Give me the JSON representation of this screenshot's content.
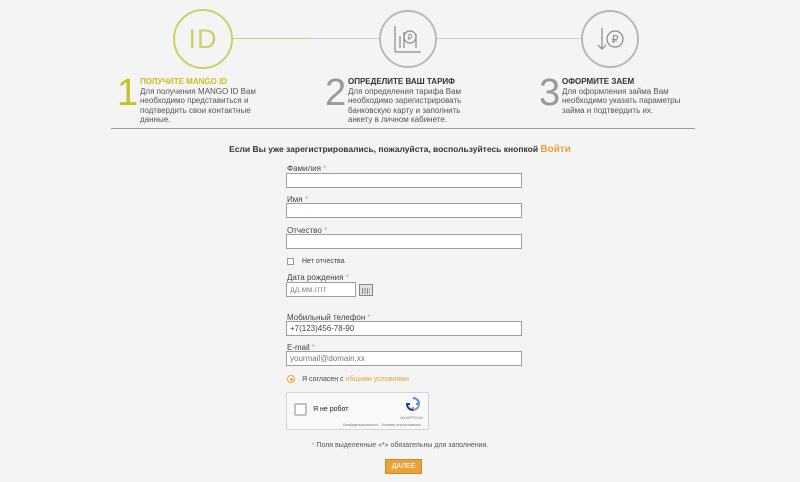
{
  "steps": [
    {
      "number": "1",
      "title": "ПОЛУЧИТЕ MANGO ID",
      "text": "Для получения MANGO ID Вам необходимо представиться и подтвердить свои контактные данные.",
      "icon": "id-icon",
      "circle_label": "ID"
    },
    {
      "number": "2",
      "title": "ОПРЕДЕЛИТЕ ВАШ ТАРИФ",
      "text": "Для определения тарифа Вам необходимо зарегистрировать банковскую карту и заполнить анкету в личном кабинете.",
      "icon": "tariff-chart-icon"
    },
    {
      "number": "3",
      "title": "ОФОРМИТЕ ЗАЕМ",
      "text": "Для оформления займа Вам необходимо указать параметры займа и подтвердить их.",
      "icon": "ruble-down-icon"
    }
  ],
  "intro": {
    "text": "Если Вы уже зарегистрировались, пожалуйста, воспользуйтесь кнопкой ",
    "login_link": "Войти"
  },
  "form": {
    "required_mark": "*",
    "lastname_label": "Фамилия",
    "firstname_label": "Имя",
    "middlename_label": "Отчество",
    "no_middlename_label": "Нет отчества",
    "birthdate_label": "Дата рождения",
    "birthdate_placeholder": "дд.мм.гггг",
    "phone_label": "Мобильный телефон",
    "phone_placeholder": "+7(123)456-78-90",
    "email_label": "E-mail",
    "email_placeholder": "yourmail@domain.xx",
    "agree_text": "Я согласен с ",
    "agree_link": "общими условиями"
  },
  "captcha": {
    "label": "Я не робот",
    "brand": "reCAPTCHA",
    "links": "Конфиденциальность · Условия использования"
  },
  "note": {
    "text": "Поля выделенные «*» обязательны для заполнения."
  },
  "submit_label": "ДАЛЕЕ",
  "colors": {
    "accent": "#e8a23a",
    "step_active": "#c6c320",
    "circle_active": "#c9d36a"
  }
}
